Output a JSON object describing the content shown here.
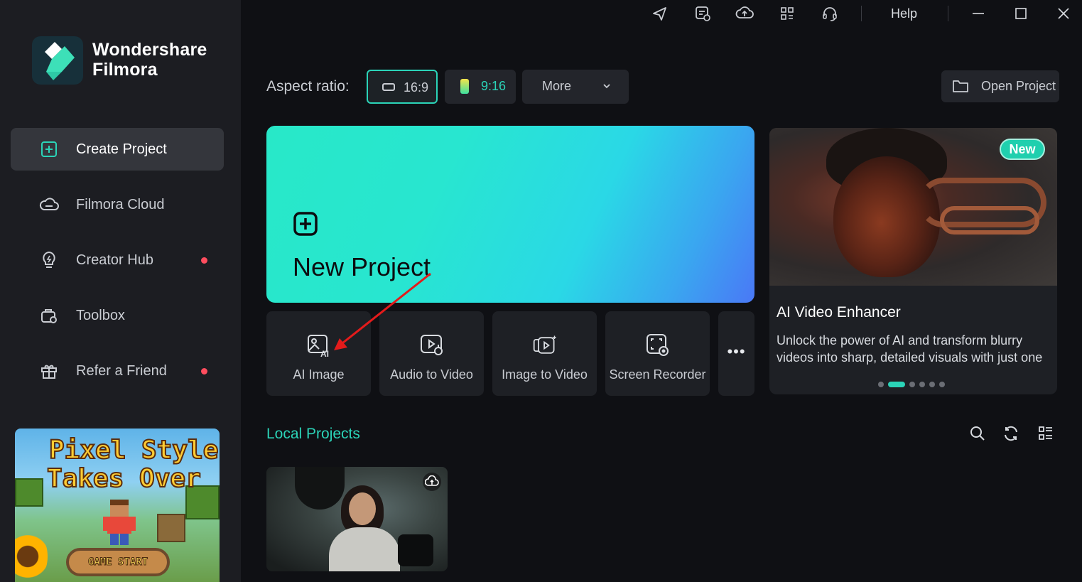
{
  "app": {
    "brand_line1": "Wondershare",
    "brand_line2": "Filmora"
  },
  "sidebar": {
    "items": [
      {
        "label": "Create Project",
        "icon": "plus-square-icon",
        "active": true
      },
      {
        "label": "Filmora Cloud",
        "icon": "cloud-icon"
      },
      {
        "label": "Creator Hub",
        "icon": "lightbulb-icon",
        "badge": true
      },
      {
        "label": "Toolbox",
        "icon": "toolbox-icon"
      },
      {
        "label": "Refer a Friend",
        "icon": "gift-icon",
        "badge": true
      }
    ],
    "promo": {
      "line1": "Pixel Style",
      "line2": "Takes Over",
      "button": "GAME START"
    }
  },
  "titlebar": {
    "icons": [
      "send-icon",
      "task-icon",
      "cloud-upload-icon",
      "grid-icon",
      "headset-icon"
    ],
    "help": "Help",
    "window_controls": [
      "minimize-icon",
      "maximize-icon",
      "close-icon"
    ]
  },
  "aspect": {
    "label": "Aspect ratio:",
    "options": [
      {
        "label": "16:9",
        "selected": true
      },
      {
        "label": "9:16"
      }
    ],
    "more": "More"
  },
  "open_project": "Open Project",
  "new_project": {
    "label": "New Project"
  },
  "tools": [
    {
      "label": "AI Image",
      "icon": "ai-image-icon"
    },
    {
      "label": "Audio to Video",
      "icon": "audio-to-video-icon"
    },
    {
      "label": "Image to Video",
      "icon": "image-to-video-icon"
    },
    {
      "label": "Screen Recorder",
      "icon": "screen-recorder-icon"
    }
  ],
  "tools_more": "•••",
  "feature": {
    "badge": "New",
    "title": "AI Video Enhancer",
    "description": "Unlock the power of AI and transform blurry videos into sharp, detailed visuals with just one",
    "pages": 6,
    "active_page": 1
  },
  "local_projects": {
    "title": "Local Projects"
  },
  "colors": {
    "accent": "#2bd4b8",
    "badge_dot": "#ff4d5e",
    "annotation_arrow": "#e31b1b"
  }
}
